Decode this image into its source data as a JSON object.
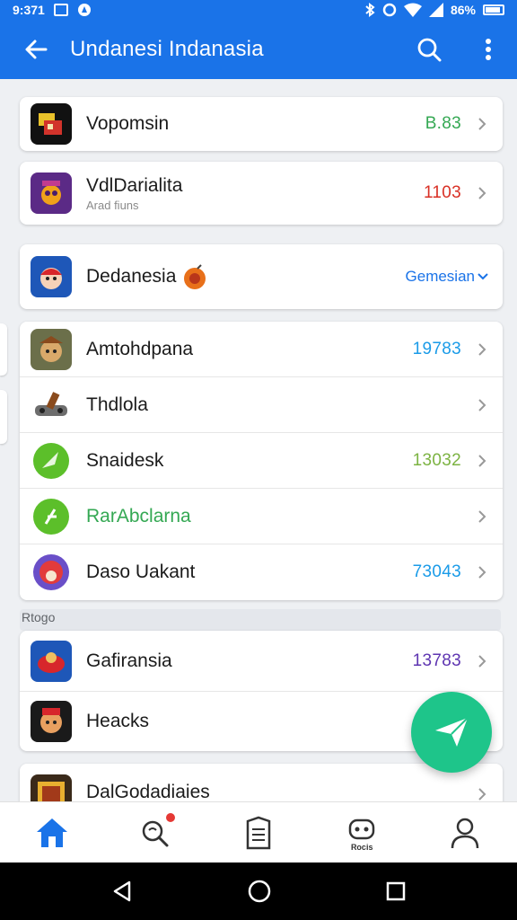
{
  "status_bar": {
    "time": "9:371"
  },
  "app_bar": {
    "title": "Undanesi Indanasia"
  },
  "rows": [
    {
      "title": "Vopomsin",
      "value": "B.83",
      "value_color": "#34a853"
    },
    {
      "title": "VdlDarialita",
      "subtitle": "Arad fiuns",
      "value": "1103",
      "value_color": "#d93025"
    },
    {
      "title": "Dedanesia",
      "dropdown": "Gemesian",
      "dropdown_color": "#1a73e8"
    },
    {
      "title": "Amtohdpana",
      "value": "19783",
      "value_color": "#1a9be8"
    },
    {
      "title": "Thdlola",
      "value": ""
    },
    {
      "title": "Snaidesk",
      "value": "13032",
      "value_color": "#7cb342"
    },
    {
      "title": "RarAbclarna",
      "title_color": "#34a853",
      "value": ""
    },
    {
      "title": "Daso Uakant",
      "value": "73043",
      "value_color": "#1a9be8"
    },
    {
      "title": "Gafiransia",
      "value": "13783",
      "value_color": "#5e35b1"
    },
    {
      "title": "Heacks",
      "value": ""
    },
    {
      "title": "DalGodadiaies",
      "value": ""
    }
  ],
  "section_label": "Rtogo",
  "bottom_nav": {
    "items": [
      "home-icon",
      "search-notify-icon",
      "document-icon",
      "robot-icon",
      "profile-icon"
    ],
    "robot_caption": "Rocis"
  },
  "colors": {
    "primary": "#1a73e8",
    "fab": "#1ec58a"
  }
}
